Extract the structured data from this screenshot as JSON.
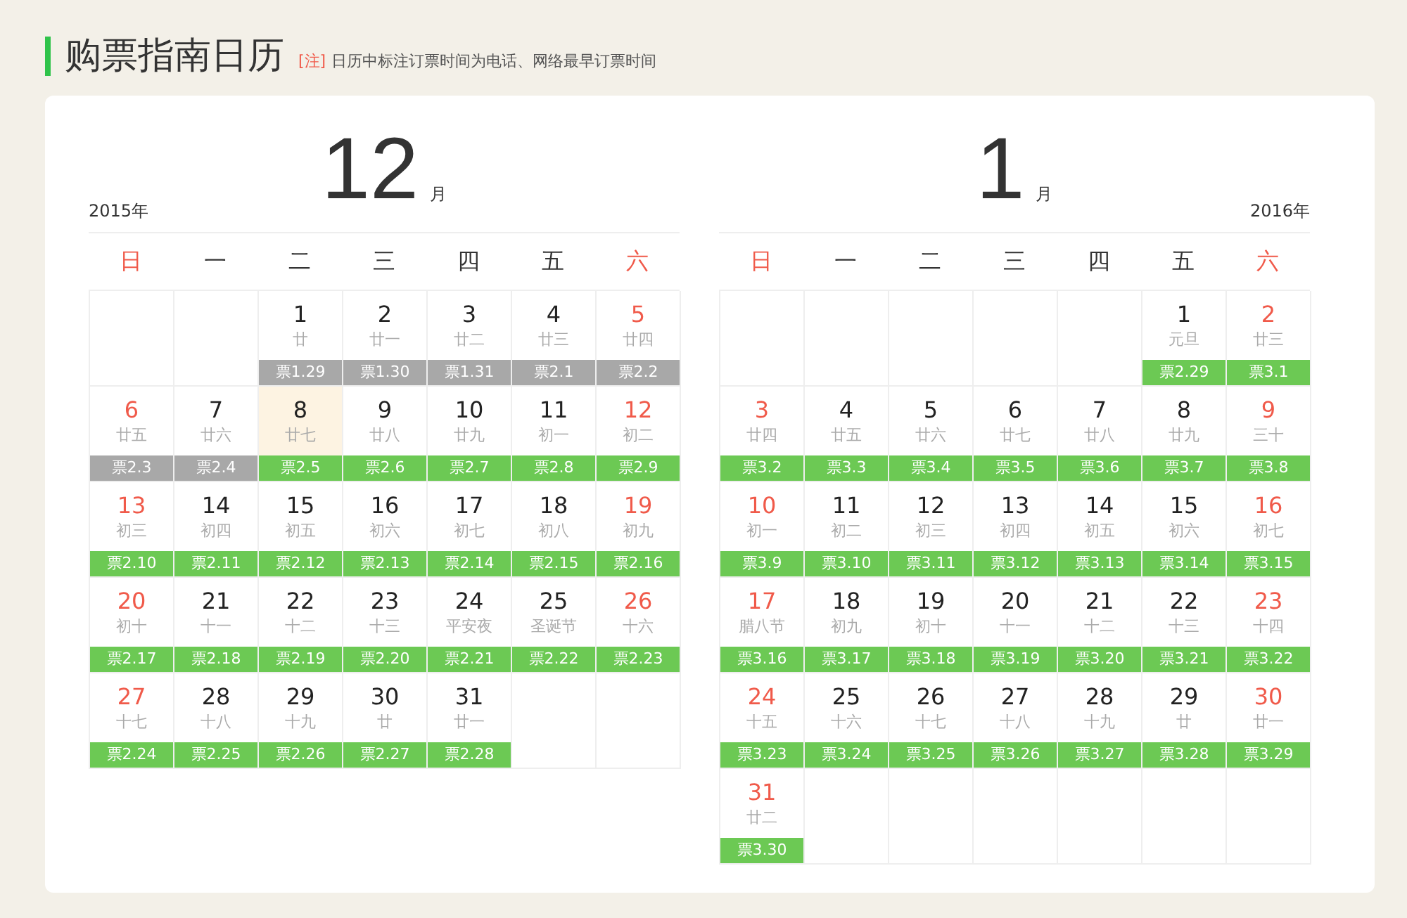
{
  "title": "购票指南日历",
  "note": {
    "tag": "[注]",
    "text": "日历中标注订票时间为电话、网络最早订票时间"
  },
  "months": [
    {
      "year": "2015年",
      "month": "12",
      "unit": "月",
      "weekdays": [
        {
          "label": "日",
          "weekend": true
        },
        {
          "label": "一",
          "weekend": false
        },
        {
          "label": "二",
          "weekend": false
        },
        {
          "label": "三",
          "weekend": false
        },
        {
          "label": "四",
          "weekend": false
        },
        {
          "label": "五",
          "weekend": false
        },
        {
          "label": "六",
          "weekend": true
        }
      ],
      "weeks": [
        [
          {
            "kind": "blank"
          },
          {
            "kind": "blank"
          },
          {
            "day": "1",
            "lunar": "廿",
            "ticket": "票1.29",
            "past": true,
            "selected": false
          },
          {
            "day": "2",
            "lunar": "廿一",
            "ticket": "票1.30",
            "past": true,
            "selected": false
          },
          {
            "day": "3",
            "lunar": "廿二",
            "ticket": "票1.31",
            "past": true,
            "selected": false
          },
          {
            "day": "4",
            "lunar": "廿三",
            "ticket": "票2.1",
            "past": true,
            "selected": false
          },
          {
            "day": "5",
            "lunar": "廿四",
            "ticket": "票2.2",
            "past": true,
            "selected": false
          }
        ],
        [
          {
            "day": "6",
            "lunar": "廿五",
            "ticket": "票2.3",
            "past": true,
            "selected": false
          },
          {
            "day": "7",
            "lunar": "廿六",
            "ticket": "票2.4",
            "past": true,
            "selected": false
          },
          {
            "day": "8",
            "lunar": "廿七",
            "ticket": "票2.5",
            "past": false,
            "selected": true
          },
          {
            "day": "9",
            "lunar": "廿八",
            "ticket": "票2.6",
            "past": false,
            "selected": false
          },
          {
            "day": "10",
            "lunar": "廿九",
            "ticket": "票2.7",
            "past": false,
            "selected": false
          },
          {
            "day": "11",
            "lunar": "初一",
            "ticket": "票2.8",
            "past": false,
            "selected": false
          },
          {
            "day": "12",
            "lunar": "初二",
            "ticket": "票2.9",
            "past": false,
            "selected": false
          }
        ],
        [
          {
            "day": "13",
            "lunar": "初三",
            "ticket": "票2.10",
            "past": false,
            "selected": false
          },
          {
            "day": "14",
            "lunar": "初四",
            "ticket": "票2.11",
            "past": false,
            "selected": false
          },
          {
            "day": "15",
            "lunar": "初五",
            "ticket": "票2.12",
            "past": false,
            "selected": false
          },
          {
            "day": "16",
            "lunar": "初六",
            "ticket": "票2.13",
            "past": false,
            "selected": false
          },
          {
            "day": "17",
            "lunar": "初七",
            "ticket": "票2.14",
            "past": false,
            "selected": false
          },
          {
            "day": "18",
            "lunar": "初八",
            "ticket": "票2.15",
            "past": false,
            "selected": false
          },
          {
            "day": "19",
            "lunar": "初九",
            "ticket": "票2.16",
            "past": false,
            "selected": false
          }
        ],
        [
          {
            "day": "20",
            "lunar": "初十",
            "ticket": "票2.17",
            "past": false,
            "selected": false
          },
          {
            "day": "21",
            "lunar": "十一",
            "ticket": "票2.18",
            "past": false,
            "selected": false
          },
          {
            "day": "22",
            "lunar": "十二",
            "ticket": "票2.19",
            "past": false,
            "selected": false
          },
          {
            "day": "23",
            "lunar": "十三",
            "ticket": "票2.20",
            "past": false,
            "selected": false
          },
          {
            "day": "24",
            "lunar": "平安夜",
            "ticket": "票2.21",
            "past": false,
            "selected": false
          },
          {
            "day": "25",
            "lunar": "圣诞节",
            "ticket": "票2.22",
            "past": false,
            "selected": false
          },
          {
            "day": "26",
            "lunar": "十六",
            "ticket": "票2.23",
            "past": false,
            "selected": false
          }
        ],
        [
          {
            "day": "27",
            "lunar": "十七",
            "ticket": "票2.24",
            "past": false,
            "selected": false
          },
          {
            "day": "28",
            "lunar": "十八",
            "ticket": "票2.25",
            "past": false,
            "selected": false
          },
          {
            "day": "29",
            "lunar": "十九",
            "ticket": "票2.26",
            "past": false,
            "selected": false
          },
          {
            "day": "30",
            "lunar": "廿",
            "ticket": "票2.27",
            "past": false,
            "selected": false
          },
          {
            "day": "31",
            "lunar": "廿一",
            "ticket": "票2.28",
            "past": false,
            "selected": false
          },
          {
            "kind": "blank"
          },
          {
            "kind": "blank"
          }
        ]
      ]
    },
    {
      "year": "2016年",
      "month": "1",
      "unit": "月",
      "weekdays": [
        {
          "label": "日",
          "weekend": true
        },
        {
          "label": "一",
          "weekend": false
        },
        {
          "label": "二",
          "weekend": false
        },
        {
          "label": "三",
          "weekend": false
        },
        {
          "label": "四",
          "weekend": false
        },
        {
          "label": "五",
          "weekend": false
        },
        {
          "label": "六",
          "weekend": true
        }
      ],
      "weeks": [
        [
          {
            "kind": "blank"
          },
          {
            "kind": "blank"
          },
          {
            "kind": "blank"
          },
          {
            "kind": "blank"
          },
          {
            "kind": "blank"
          },
          {
            "day": "1",
            "lunar": "元旦",
            "ticket": "票2.29",
            "past": false,
            "selected": false
          },
          {
            "day": "2",
            "lunar": "廿三",
            "ticket": "票3.1",
            "past": false,
            "selected": false
          }
        ],
        [
          {
            "day": "3",
            "lunar": "廿四",
            "ticket": "票3.2",
            "past": false,
            "selected": false
          },
          {
            "day": "4",
            "lunar": "廿五",
            "ticket": "票3.3",
            "past": false,
            "selected": false
          },
          {
            "day": "5",
            "lunar": "廿六",
            "ticket": "票3.4",
            "past": false,
            "selected": false
          },
          {
            "day": "6",
            "lunar": "廿七",
            "ticket": "票3.5",
            "past": false,
            "selected": false
          },
          {
            "day": "7",
            "lunar": "廿八",
            "ticket": "票3.6",
            "past": false,
            "selected": false
          },
          {
            "day": "8",
            "lunar": "廿九",
            "ticket": "票3.7",
            "past": false,
            "selected": false
          },
          {
            "day": "9",
            "lunar": "三十",
            "ticket": "票3.8",
            "past": false,
            "selected": false
          }
        ],
        [
          {
            "day": "10",
            "lunar": "初一",
            "ticket": "票3.9",
            "past": false,
            "selected": false
          },
          {
            "day": "11",
            "lunar": "初二",
            "ticket": "票3.10",
            "past": false,
            "selected": false
          },
          {
            "day": "12",
            "lunar": "初三",
            "ticket": "票3.11",
            "past": false,
            "selected": false
          },
          {
            "day": "13",
            "lunar": "初四",
            "ticket": "票3.12",
            "past": false,
            "selected": false
          },
          {
            "day": "14",
            "lunar": "初五",
            "ticket": "票3.13",
            "past": false,
            "selected": false
          },
          {
            "day": "15",
            "lunar": "初六",
            "ticket": "票3.14",
            "past": false,
            "selected": false
          },
          {
            "day": "16",
            "lunar": "初七",
            "ticket": "票3.15",
            "past": false,
            "selected": false
          }
        ],
        [
          {
            "day": "17",
            "lunar": "腊八节",
            "ticket": "票3.16",
            "past": false,
            "selected": false
          },
          {
            "day": "18",
            "lunar": "初九",
            "ticket": "票3.17",
            "past": false,
            "selected": false
          },
          {
            "day": "19",
            "lunar": "初十",
            "ticket": "票3.18",
            "past": false,
            "selected": false
          },
          {
            "day": "20",
            "lunar": "十一",
            "ticket": "票3.19",
            "past": false,
            "selected": false
          },
          {
            "day": "21",
            "lunar": "十二",
            "ticket": "票3.20",
            "past": false,
            "selected": false
          },
          {
            "day": "22",
            "lunar": "十三",
            "ticket": "票3.21",
            "past": false,
            "selected": false
          },
          {
            "day": "23",
            "lunar": "十四",
            "ticket": "票3.22",
            "past": false,
            "selected": false
          }
        ],
        [
          {
            "day": "24",
            "lunar": "十五",
            "ticket": "票3.23",
            "past": false,
            "selected": false
          },
          {
            "day": "25",
            "lunar": "十六",
            "ticket": "票3.24",
            "past": false,
            "selected": false
          },
          {
            "day": "26",
            "lunar": "十七",
            "ticket": "票3.25",
            "past": false,
            "selected": false
          },
          {
            "day": "27",
            "lunar": "十八",
            "ticket": "票3.26",
            "past": false,
            "selected": false
          },
          {
            "day": "28",
            "lunar": "十九",
            "ticket": "票3.27",
            "past": false,
            "selected": false
          },
          {
            "day": "29",
            "lunar": "廿",
            "ticket": "票3.28",
            "past": false,
            "selected": false
          },
          {
            "day": "30",
            "lunar": "廿一",
            "ticket": "票3.29",
            "past": false,
            "selected": false
          }
        ],
        [
          {
            "day": "31",
            "lunar": "廿二",
            "ticket": "票3.30",
            "past": false,
            "selected": false
          },
          {
            "kind": "blank"
          },
          {
            "kind": "blank"
          },
          {
            "kind": "blank"
          },
          {
            "kind": "blank"
          },
          {
            "kind": "blank"
          },
          {
            "kind": "blank"
          }
        ]
      ]
    }
  ]
}
